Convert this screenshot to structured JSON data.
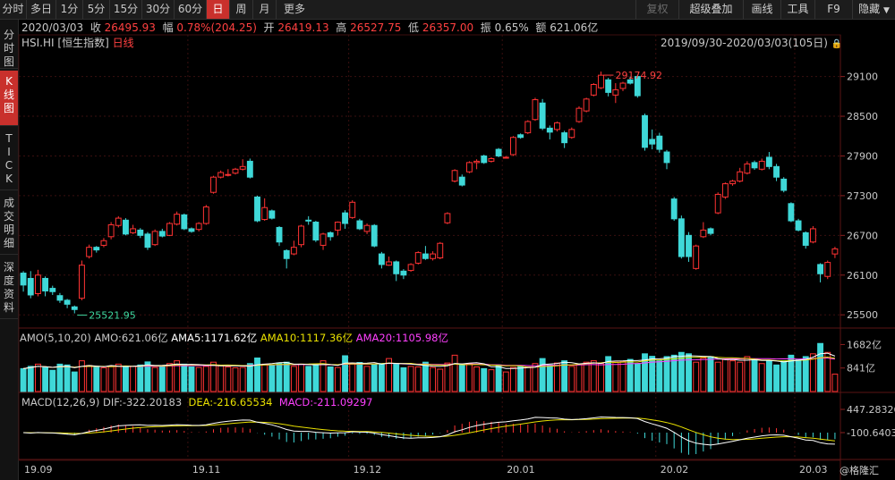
{
  "toolbar": {
    "periods": [
      "分时",
      "多日",
      "1分",
      "5分",
      "15分",
      "30分",
      "60分",
      "日",
      "周",
      "月",
      "更多"
    ],
    "active_period": "日",
    "tools": [
      "复权",
      "超级叠加",
      "画线",
      "工具",
      "F9",
      "隐藏"
    ]
  },
  "left_nav": [
    {
      "label": "分时图",
      "active": false
    },
    {
      "label": "K线图",
      "active": true
    },
    {
      "label": "TICK",
      "active": false
    },
    {
      "label": "成交明细",
      "active": false
    },
    {
      "label": "深度资料",
      "active": false
    }
  ],
  "quote": {
    "date": "2020/03/03",
    "close_label": "收",
    "close": "26495.93",
    "change_label": "幅",
    "change": "0.78%(204.25)",
    "open_label": "开",
    "open": "26419.13",
    "high_label": "高",
    "high": "26527.75",
    "low_label": "低",
    "low": "26357.00",
    "amplitude_label": "振",
    "amplitude": "0.65%",
    "amount_label": "额",
    "amount": "621.06亿"
  },
  "symbol": {
    "code": "HSI.HI",
    "name": "[恒生指数]",
    "period": "日线"
  },
  "range_text": "2019/09/30-2020/03/03(105日)",
  "watermark": "@格隆汇",
  "colors": {
    "up": "#ff3333",
    "down": "#3fd8d8",
    "grid": "#3a1010",
    "amo5": "#ffffff",
    "amo10": "#e8e000",
    "amo20": "#ff40ff",
    "dif": "#ffffff",
    "dea": "#e8e000"
  },
  "chart_data": [
    {
      "type": "candlestick",
      "title": "HSI.HI [恒生指数] 日线",
      "y_axis_ticks": [
        29100,
        28500,
        27900,
        27300,
        26700,
        26100,
        25500
      ],
      "ylim": [
        25300,
        29500
      ],
      "x_axis_labels": [
        "19.09",
        "19.11",
        "19.12",
        "20.01",
        "20.02",
        "20.03"
      ],
      "annotations": [
        {
          "text": "29174.92",
          "kind": "high"
        },
        {
          "text": "25521.95",
          "kind": "low"
        }
      ],
      "candles": [
        {
          "o": 26130,
          "c": 25950,
          "h": 26160,
          "l": 25850
        },
        {
          "o": 26050,
          "c": 25800,
          "h": 26160,
          "l": 25750
        },
        {
          "o": 25820,
          "c": 26100,
          "h": 26180,
          "l": 25780
        },
        {
          "o": 26050,
          "c": 25860,
          "h": 26080,
          "l": 25780
        },
        {
          "o": 25900,
          "c": 25850,
          "h": 25940,
          "l": 25800
        },
        {
          "o": 25790,
          "c": 25720,
          "h": 25830,
          "l": 25680
        },
        {
          "o": 25720,
          "c": 25660,
          "h": 25740,
          "l": 25600
        },
        {
          "o": 25620,
          "c": 25580,
          "h": 25640,
          "l": 25522
        },
        {
          "o": 25750,
          "c": 26250,
          "h": 26320,
          "l": 25720
        },
        {
          "o": 26380,
          "c": 26520,
          "h": 26560,
          "l": 26350
        },
        {
          "o": 26520,
          "c": 26480,
          "h": 26540,
          "l": 26440
        },
        {
          "o": 26550,
          "c": 26620,
          "h": 26660,
          "l": 26520
        },
        {
          "o": 26680,
          "c": 26860,
          "h": 26900,
          "l": 26640
        },
        {
          "o": 26850,
          "c": 26960,
          "h": 26990,
          "l": 26820
        },
        {
          "o": 26930,
          "c": 26720,
          "h": 26960,
          "l": 26700
        },
        {
          "o": 26740,
          "c": 26800,
          "h": 26860,
          "l": 26720
        },
        {
          "o": 26780,
          "c": 26700,
          "h": 26810,
          "l": 26660
        },
        {
          "o": 26720,
          "c": 26520,
          "h": 26750,
          "l": 26480
        },
        {
          "o": 26560,
          "c": 26760,
          "h": 26790,
          "l": 26540
        },
        {
          "o": 26760,
          "c": 26690,
          "h": 26800,
          "l": 26670
        },
        {
          "o": 26700,
          "c": 26880,
          "h": 26900,
          "l": 26690
        },
        {
          "o": 26870,
          "c": 27020,
          "h": 27060,
          "l": 26850
        },
        {
          "o": 27010,
          "c": 26800,
          "h": 27030,
          "l": 26780
        },
        {
          "o": 26800,
          "c": 26760,
          "h": 26820,
          "l": 26740
        },
        {
          "o": 26790,
          "c": 26880,
          "h": 26900,
          "l": 26760
        },
        {
          "o": 26880,
          "c": 27130,
          "h": 27160,
          "l": 26860
        },
        {
          "o": 27350,
          "c": 27580,
          "h": 27600,
          "l": 27330
        },
        {
          "o": 27580,
          "c": 27650,
          "h": 27680,
          "l": 27560
        },
        {
          "o": 27610,
          "c": 27620,
          "h": 27700,
          "l": 27590
        },
        {
          "o": 27640,
          "c": 27700,
          "h": 27720,
          "l": 27620
        },
        {
          "o": 27700,
          "c": 27740,
          "h": 27850,
          "l": 27680
        },
        {
          "o": 27820,
          "c": 27580,
          "h": 27860,
          "l": 27560
        },
        {
          "o": 27280,
          "c": 26920,
          "h": 27300,
          "l": 26900
        },
        {
          "o": 26940,
          "c": 27120,
          "h": 27260,
          "l": 26920
        },
        {
          "o": 27070,
          "c": 26960,
          "h": 27090,
          "l": 26940
        },
        {
          "o": 26820,
          "c": 26600,
          "h": 26840,
          "l": 26540
        },
        {
          "o": 26470,
          "c": 26350,
          "h": 26490,
          "l": 26200
        },
        {
          "o": 26420,
          "c": 26520,
          "h": 26620,
          "l": 26400
        },
        {
          "o": 26560,
          "c": 26840,
          "h": 26860,
          "l": 26520
        },
        {
          "o": 26930,
          "c": 26920,
          "h": 26990,
          "l": 26860
        },
        {
          "o": 26900,
          "c": 26630,
          "h": 26920,
          "l": 26600
        },
        {
          "o": 26550,
          "c": 26720,
          "h": 26740,
          "l": 26480
        },
        {
          "o": 26740,
          "c": 26680,
          "h": 26760,
          "l": 26620
        },
        {
          "o": 26780,
          "c": 26900,
          "h": 26910,
          "l": 26700
        },
        {
          "o": 27040,
          "c": 26880,
          "h": 27080,
          "l": 26800
        },
        {
          "o": 26970,
          "c": 27200,
          "h": 27230,
          "l": 26950
        },
        {
          "o": 26920,
          "c": 26800,
          "h": 26950,
          "l": 26780
        },
        {
          "o": 26760,
          "c": 26850,
          "h": 26880,
          "l": 26720
        },
        {
          "o": 26850,
          "c": 26540,
          "h": 26870,
          "l": 26520
        },
        {
          "o": 26420,
          "c": 26260,
          "h": 26450,
          "l": 26200
        },
        {
          "o": 26250,
          "c": 26300,
          "h": 26380,
          "l": 26240
        },
        {
          "o": 26300,
          "c": 26120,
          "h": 26320,
          "l": 26010
        },
        {
          "o": 26160,
          "c": 26100,
          "h": 26190,
          "l": 26040
        },
        {
          "o": 26170,
          "c": 26260,
          "h": 26280,
          "l": 26150
        },
        {
          "o": 26280,
          "c": 26440,
          "h": 26460,
          "l": 26260
        },
        {
          "o": 26420,
          "c": 26350,
          "h": 26540,
          "l": 26330
        },
        {
          "o": 26350,
          "c": 26420,
          "h": 26460,
          "l": 26320
        },
        {
          "o": 26360,
          "c": 26580,
          "h": 26600,
          "l": 26340
        },
        {
          "o": 26890,
          "c": 27030,
          "h": 27050,
          "l": 26870
        },
        {
          "o": 27520,
          "c": 27680,
          "h": 27700,
          "l": 27500
        },
        {
          "o": 27580,
          "c": 27460,
          "h": 27620,
          "l": 27440
        },
        {
          "o": 27660,
          "c": 27800,
          "h": 27820,
          "l": 27640
        },
        {
          "o": 27800,
          "c": 27820,
          "h": 27850,
          "l": 27700
        },
        {
          "o": 27900,
          "c": 27800,
          "h": 27920,
          "l": 27780
        },
        {
          "o": 27820,
          "c": 27860,
          "h": 27880,
          "l": 27800
        },
        {
          "o": 28000,
          "c": 27900,
          "h": 28020,
          "l": 27880
        },
        {
          "o": 27880,
          "c": 27880,
          "h": 27900,
          "l": 27860
        },
        {
          "o": 27920,
          "c": 28180,
          "h": 28200,
          "l": 27900
        },
        {
          "o": 28220,
          "c": 28180,
          "h": 28240,
          "l": 28160
        },
        {
          "o": 28250,
          "c": 28420,
          "h": 28440,
          "l": 28230
        },
        {
          "o": 28450,
          "c": 28750,
          "h": 28780,
          "l": 28430
        },
        {
          "o": 28700,
          "c": 28320,
          "h": 28760,
          "l": 28290
        },
        {
          "o": 28320,
          "c": 28260,
          "h": 28360,
          "l": 28150
        },
        {
          "o": 28300,
          "c": 28400,
          "h": 28420,
          "l": 28270
        },
        {
          "o": 28250,
          "c": 28100,
          "h": 28280,
          "l": 28020
        },
        {
          "o": 28180,
          "c": 28300,
          "h": 28330,
          "l": 28160
        },
        {
          "o": 28420,
          "c": 28620,
          "h": 28650,
          "l": 28400
        },
        {
          "o": 28580,
          "c": 28760,
          "h": 28780,
          "l": 28560
        },
        {
          "o": 28820,
          "c": 28980,
          "h": 29000,
          "l": 28800
        },
        {
          "o": 28930,
          "c": 29120,
          "h": 29174.92,
          "l": 28910
        },
        {
          "o": 29050,
          "c": 28860,
          "h": 29080,
          "l": 28800
        },
        {
          "o": 28820,
          "c": 28900,
          "h": 29000,
          "l": 28700
        },
        {
          "o": 28920,
          "c": 29000,
          "h": 29020,
          "l": 28880
        },
        {
          "o": 29050,
          "c": 29000,
          "h": 29100,
          "l": 28980
        },
        {
          "o": 29100,
          "c": 28810,
          "h": 29120,
          "l": 28780
        },
        {
          "o": 28510,
          "c": 28030,
          "h": 28540,
          "l": 27980
        },
        {
          "o": 28150,
          "c": 28080,
          "h": 28300,
          "l": 28000
        },
        {
          "o": 28200,
          "c": 28000,
          "h": 28250,
          "l": 27950
        },
        {
          "o": 27960,
          "c": 27800,
          "h": 27990,
          "l": 27700
        },
        {
          "o": 27250,
          "c": 26950,
          "h": 27280,
          "l": 26920
        },
        {
          "o": 26950,
          "c": 26380,
          "h": 27000,
          "l": 26350
        },
        {
          "o": 26700,
          "c": 26380,
          "h": 26750,
          "l": 26300
        },
        {
          "o": 26200,
          "c": 26540,
          "h": 26560,
          "l": 26180
        },
        {
          "o": 26680,
          "c": 26780,
          "h": 26900,
          "l": 26660
        },
        {
          "o": 26800,
          "c": 26730,
          "h": 26820,
          "l": 26700
        },
        {
          "o": 27040,
          "c": 27320,
          "h": 27350,
          "l": 27020
        },
        {
          "o": 27280,
          "c": 27480,
          "h": 27500,
          "l": 27250
        },
        {
          "o": 27480,
          "c": 27520,
          "h": 27540,
          "l": 27450
        },
        {
          "o": 27520,
          "c": 27660,
          "h": 27720,
          "l": 27500
        },
        {
          "o": 27640,
          "c": 27780,
          "h": 27820,
          "l": 27620
        },
        {
          "o": 27800,
          "c": 27720,
          "h": 27830,
          "l": 27690
        },
        {
          "o": 27700,
          "c": 27820,
          "h": 27860,
          "l": 27680
        },
        {
          "o": 27880,
          "c": 27740,
          "h": 27960,
          "l": 27700
        },
        {
          "o": 27740,
          "c": 27580,
          "h": 27780,
          "l": 27520
        },
        {
          "o": 27550,
          "c": 27380,
          "h": 27580,
          "l": 27350
        },
        {
          "o": 27180,
          "c": 26920,
          "h": 27200,
          "l": 26900
        },
        {
          "o": 26920,
          "c": 26780,
          "h": 26950,
          "l": 26760
        },
        {
          "o": 26740,
          "c": 26550,
          "h": 26760,
          "l": 26500
        },
        {
          "o": 26600,
          "c": 26800,
          "h": 26840,
          "l": 26580
        },
        {
          "o": 26260,
          "c": 26120,
          "h": 26280,
          "l": 25990
        },
        {
          "o": 26080,
          "c": 26291.68,
          "h": 26320,
          "l": 26040
        },
        {
          "o": 26419.13,
          "c": 26495.93,
          "h": 26527.75,
          "l": 26357.0
        }
      ]
    },
    {
      "type": "bar",
      "title": "AMO(5,10,20)",
      "y_axis_ticks": [
        "1682亿",
        "841亿"
      ],
      "legend": [
        {
          "label": "AMO:621.06亿",
          "color": "#c8c8c8"
        },
        {
          "label": "AMA5:1171.62亿",
          "color": "#ffffff"
        },
        {
          "label": "AMA10:1117.36亿",
          "color": "#e8e000"
        },
        {
          "label": "AMA20:1105.98亿",
          "color": "#ff40ff"
        }
      ],
      "values": [
        820,
        900,
        980,
        860,
        760,
        980,
        950,
        700,
        1100,
        930,
        870,
        850,
        900,
        980,
        880,
        900,
        950,
        1060,
        860,
        900,
        1000,
        1100,
        980,
        880,
        860,
        900,
        1050,
        920,
        880,
        850,
        860,
        1000,
        1200,
        980,
        950,
        1020,
        1050,
        900,
        980,
        900,
        950,
        1100,
        880,
        860,
        1280,
        1000,
        1040,
        900,
        960,
        1000,
        1180,
        980,
        850,
        900,
        880,
        1050,
        860,
        800,
        1020,
        1300,
        960,
        1000,
        880,
        820,
        780,
        950,
        700,
        860,
        900,
        880,
        1000,
        1180,
        950,
        1020,
        1100,
        900,
        980,
        1050,
        1100,
        1000,
        1250,
        1050,
        1080,
        1150,
        1000,
        1350,
        1260,
        1100,
        1250,
        1300,
        1400,
        1350,
        1050,
        1200,
        1250,
        1050,
        1150,
        1100,
        1050,
        1250,
        1150,
        1000,
        1100,
        950,
        1100,
        1300,
        1150,
        1250,
        1350,
        1720,
        1400,
        621
      ]
    },
    {
      "type": "line",
      "title": "MACD(12,26,9)",
      "y_axis_ticks": [
        "447.28326",
        "-100.6403"
      ],
      "legend": [
        {
          "label": "MACD(12,26,9)",
          "color": "#c8c8c8"
        },
        {
          "label": "DIF:-322.20183",
          "color": "#c8c8c8"
        },
        {
          "label": "DEA:-216.65534",
          "color": "#e8e000"
        },
        {
          "label": "MACD:-211.09297",
          "color": "#ff40ff"
        }
      ]
    }
  ]
}
